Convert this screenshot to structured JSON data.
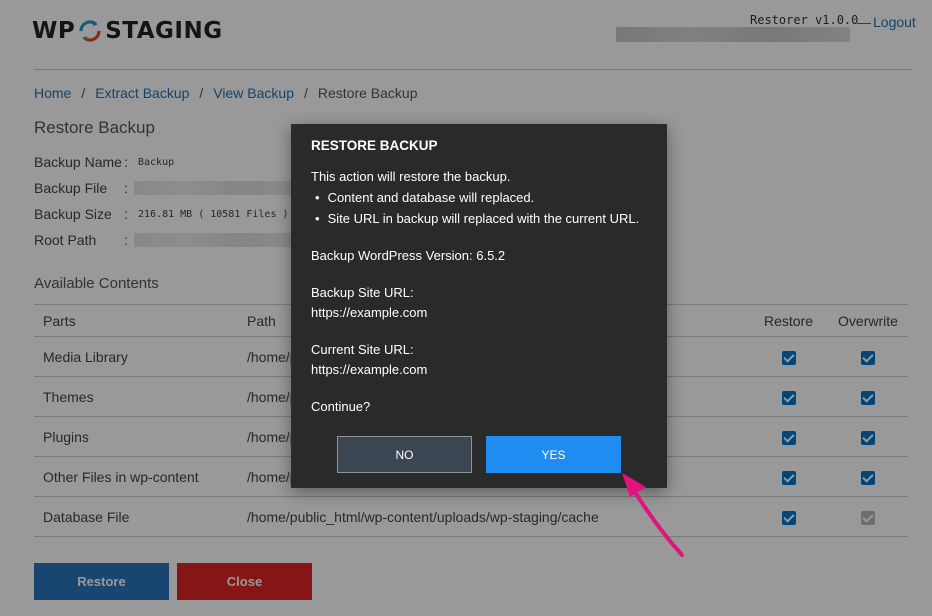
{
  "header": {
    "logo_left": "WP",
    "logo_right": "STAGING",
    "version": "Restorer v1.0.0",
    "separator": "—",
    "logout": "Logout"
  },
  "breadcrumb": {
    "items": [
      "Home",
      "Extract Backup",
      "View Backup"
    ],
    "current": "Restore Backup",
    "separator": "/"
  },
  "page_title": "Restore Backup",
  "backup_info": {
    "name_label": "Backup Name",
    "name_value": "Backup",
    "file_label": "Backup File",
    "size_label": "Backup Size",
    "size_value": "216.81 MB ( 10581 Files )",
    "root_label": "Root Path",
    "colon": ":"
  },
  "contents": {
    "title": "Available Contents",
    "headers": [
      "Parts",
      "Path",
      "Restore",
      "Overwrite"
    ],
    "rows": [
      {
        "part": "Media Library",
        "path": "/home/public_html/wp-content/uploads"
      },
      {
        "part": "Themes",
        "path": "/home/public_html/wp-content/themes"
      },
      {
        "part": "Plugins",
        "path": "/home/public_html/wp-content/plugins"
      },
      {
        "part": "Other Files in wp-content",
        "path": "/home/public_html/wp-content"
      },
      {
        "part": "Database File",
        "path": "/home/public_html/wp-content/uploads/wp-staging/cache"
      }
    ]
  },
  "buttons": {
    "restore": "Restore",
    "close": "Close"
  },
  "modal": {
    "title": "RESTORE BACKUP",
    "intro": "This action will restore the backup.",
    "bullets": [
      "Content and database will replaced.",
      "Site URL in backup will replaced with the current URL."
    ],
    "wp_version": "Backup WordPress Version: 6.5.2",
    "backup_url_label": "Backup Site URL:",
    "backup_url": "https://example.com",
    "current_url_label": "Current Site URL:",
    "current_url": "https://example.com",
    "continue": "Continue?",
    "no": "NO",
    "yes": "YES"
  },
  "colors": {
    "link": "#2271b1",
    "restore_button": "#2b73bd",
    "close_button": "#e02424",
    "modal_bg": "#2a2a2a",
    "yes_button": "#1e8cf0",
    "arrow": "#e0147c"
  }
}
